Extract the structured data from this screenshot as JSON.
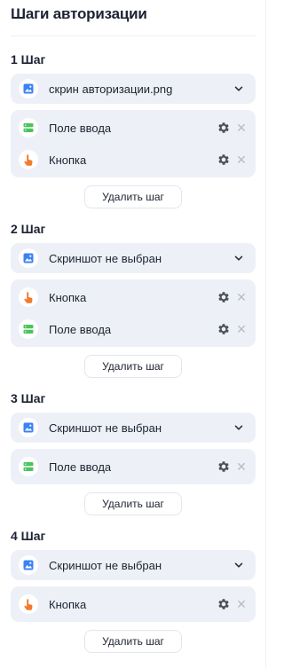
{
  "panel": {
    "title": "Шаги авторизации"
  },
  "steps": [
    {
      "label": "1 Шаг",
      "screenshot": "скрин авторизации.png",
      "items": [
        {
          "type": "input",
          "icon": "input-field-icon",
          "label": "Поле ввода"
        },
        {
          "type": "button",
          "icon": "pointer-hand-icon",
          "label": "Кнопка"
        }
      ],
      "delete_label": "Удалить шаг"
    },
    {
      "label": "2 Шаг",
      "screenshot": "Скриншот не выбран",
      "items": [
        {
          "type": "button",
          "icon": "pointer-hand-icon",
          "label": "Кнопка"
        },
        {
          "type": "input",
          "icon": "input-field-icon",
          "label": "Поле ввода"
        }
      ],
      "delete_label": "Удалить шаг"
    },
    {
      "label": "3 Шаг",
      "screenshot": "Скриншот не выбран",
      "items": [
        {
          "type": "input",
          "icon": "input-field-icon",
          "label": "Поле ввода"
        }
      ],
      "delete_label": "Удалить шаг"
    },
    {
      "label": "4 Шаг",
      "screenshot": "Скриншот не выбран",
      "items": [
        {
          "type": "button",
          "icon": "pointer-hand-icon",
          "label": "Кнопка"
        }
      ],
      "delete_label": "Удалить шаг"
    }
  ],
  "colors": {
    "image_icon": "#3b82f6",
    "input_icon": "#4cc35f",
    "button_icon": "#f07a2e",
    "card_bg": "#edf1f7",
    "gear": "#4a4f5a",
    "close": "#b7bcc6"
  }
}
